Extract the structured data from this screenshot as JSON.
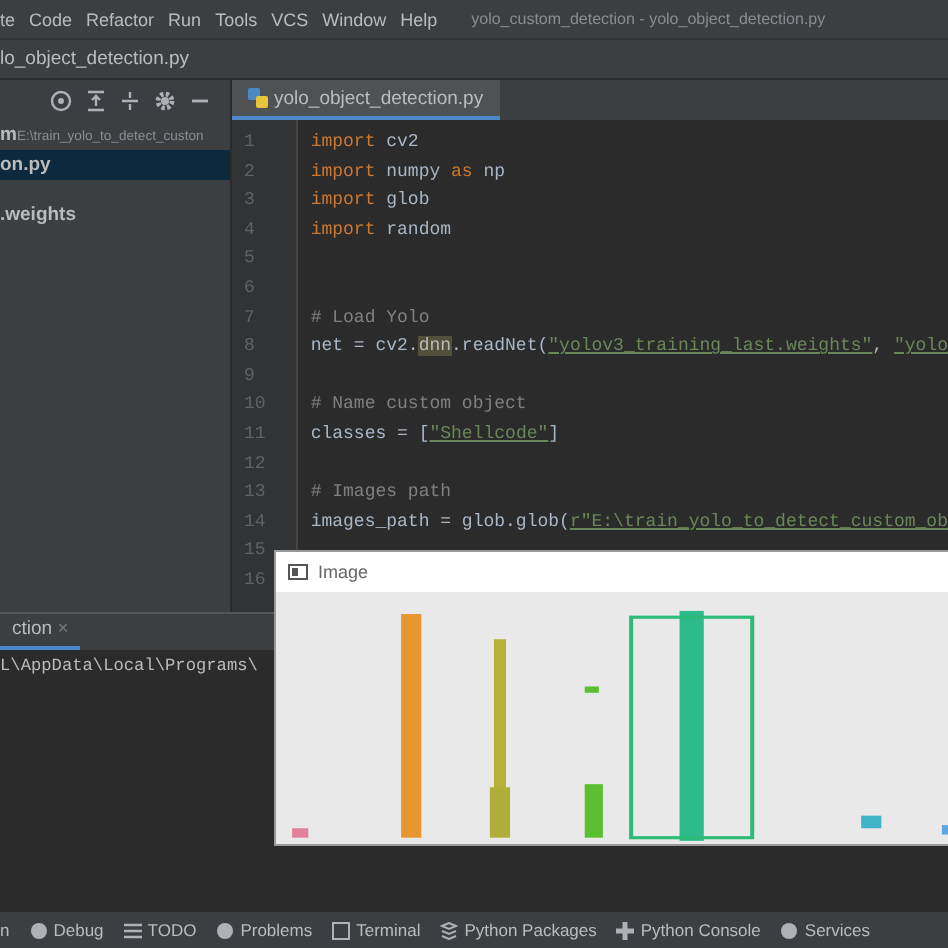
{
  "menu": [
    "te",
    "Code",
    "Refactor",
    "Run",
    "Tools",
    "VCS",
    "Window",
    "Help"
  ],
  "window": {
    "title": "yolo_custom_detection - yolo_object_detection.py"
  },
  "breadcrumb": "lo_object_detection.py",
  "editor_tab": {
    "label": "yolo_object_detection.py",
    "selected": true
  },
  "project": [
    {
      "name": "m",
      "path": "E:\\train_yolo_to_detect_custon",
      "selected": false
    },
    {
      "name": "on.py",
      "selected": true
    },
    {
      "name": ".weights",
      "selected": false
    }
  ],
  "code": [
    {
      "number": "1",
      "segments": [
        {
          "kind": "keyword",
          "text": "import"
        },
        {
          "kind": "plain",
          "text": " cv2"
        }
      ]
    },
    {
      "number": "2",
      "segments": [
        {
          "kind": "keyword",
          "text": "import"
        },
        {
          "kind": "plain",
          "text": " numpy "
        },
        {
          "kind": "keyword",
          "text": "as"
        },
        {
          "kind": "plain",
          "text": " np"
        }
      ]
    },
    {
      "number": "3",
      "segments": [
        {
          "kind": "keyword",
          "text": "import"
        },
        {
          "kind": "plain",
          "text": " glob"
        }
      ]
    },
    {
      "number": "4",
      "segments": [
        {
          "kind": "keyword",
          "text": "import"
        },
        {
          "kind": "plain",
          "text": " random"
        }
      ]
    },
    {
      "number": "5"
    },
    {
      "number": "6"
    },
    {
      "number": "7",
      "segments": [
        {
          "kind": "comment",
          "text": "# Load Yolo"
        }
      ]
    },
    {
      "number": "8",
      "segments": [
        {
          "kind": "plain",
          "text": "net = cv2."
        },
        {
          "kind": "highlight",
          "text": "dnn"
        },
        {
          "kind": "plain",
          "text": ".readNet("
        },
        {
          "kind": "string",
          "text": "\"yolov3_training_last.weights\""
        },
        {
          "kind": "plain",
          "text": ", "
        },
        {
          "kind": "string",
          "text": "\"yolo"
        }
      ]
    },
    {
      "number": "9"
    },
    {
      "number": "10",
      "segments": [
        {
          "kind": "comment",
          "text": "# Name custom object"
        }
      ]
    },
    {
      "number": "11",
      "segments": [
        {
          "kind": "plain",
          "text": "classes = ["
        },
        {
          "kind": "string",
          "text": "\"Shellcode\""
        },
        {
          "kind": "plain",
          "text": "]"
        }
      ]
    },
    {
      "number": "12"
    },
    {
      "number": "13",
      "segments": [
        {
          "kind": "comment",
          "text": "# Images path"
        }
      ]
    },
    {
      "number": "14",
      "segments": [
        {
          "kind": "plain",
          "text": "images_path = glob.glob("
        },
        {
          "kind": "string",
          "text": "r\"E:\\train_yolo_to_detect_custom_ob"
        }
      ]
    },
    {
      "number": "15"
    },
    {
      "number": "16"
    }
  ],
  "run_panel": {
    "tab": "ction",
    "close": "×",
    "output": "L\\AppData\\Local\\Programs\\"
  },
  "image_window": {
    "title": "Image",
    "kind": "picture"
  },
  "tool_windows": [
    "n",
    "Debug",
    "TODO",
    "Problems",
    "Terminal",
    "Python Packages",
    "Python Console",
    "Services"
  ]
}
